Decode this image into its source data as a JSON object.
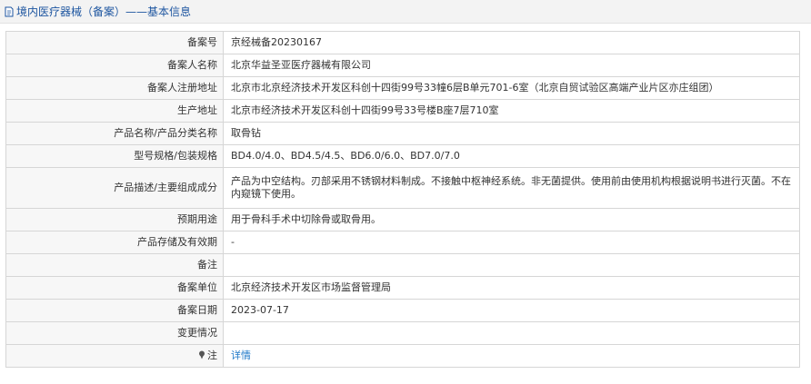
{
  "header": {
    "title": "境内医疗器械（备案）——基本信息",
    "icon": "document-icon"
  },
  "rows": [
    {
      "label": "备案号",
      "value": "京经械备20230167"
    },
    {
      "label": "备案人名称",
      "value": "北京华益圣亚医疗器械有限公司"
    },
    {
      "label": "备案人注册地址",
      "value": "北京市北京经济技术开发区科创十四街99号33幢6层B单元701-6室（北京自贸试验区高端产业片区亦庄组团）"
    },
    {
      "label": "生产地址",
      "value": "北京市经济技术开发区科创十四街99号33号楼B座7层710室"
    },
    {
      "label": "产品名称/产品分类名称",
      "value": "取骨钻"
    },
    {
      "label": "型号规格/包装规格",
      "value": "BD4.0/4.0、BD4.5/4.5、BD6.0/6.0、BD7.0/7.0"
    },
    {
      "label": "产品描述/主要组成成分",
      "value": "产品为中空结构。刃部采用不锈钢材料制成。不接触中枢神经系统。非无菌提供。使用前由使用机构根据说明书进行灭菌。不在内窥镜下使用。"
    },
    {
      "label": "预期用途",
      "value": "用于骨科手术中切除骨或取骨用。"
    },
    {
      "label": "产品存储及有效期",
      "value": "-"
    },
    {
      "label": "备注",
      "value": ""
    },
    {
      "label": "备案单位",
      "value": "北京经济技术开发区市场监督管理局"
    },
    {
      "label": "备案日期",
      "value": "2023-07-17"
    },
    {
      "label": "变更情况",
      "value": ""
    }
  ],
  "note_row": {
    "label": "注",
    "icon": "pin-icon",
    "link_text": "详情"
  },
  "colors": {
    "title": "#1e56a0",
    "link": "#1e78c8",
    "label_bg": "#f7f7f7",
    "border": "#d6d6d6"
  }
}
